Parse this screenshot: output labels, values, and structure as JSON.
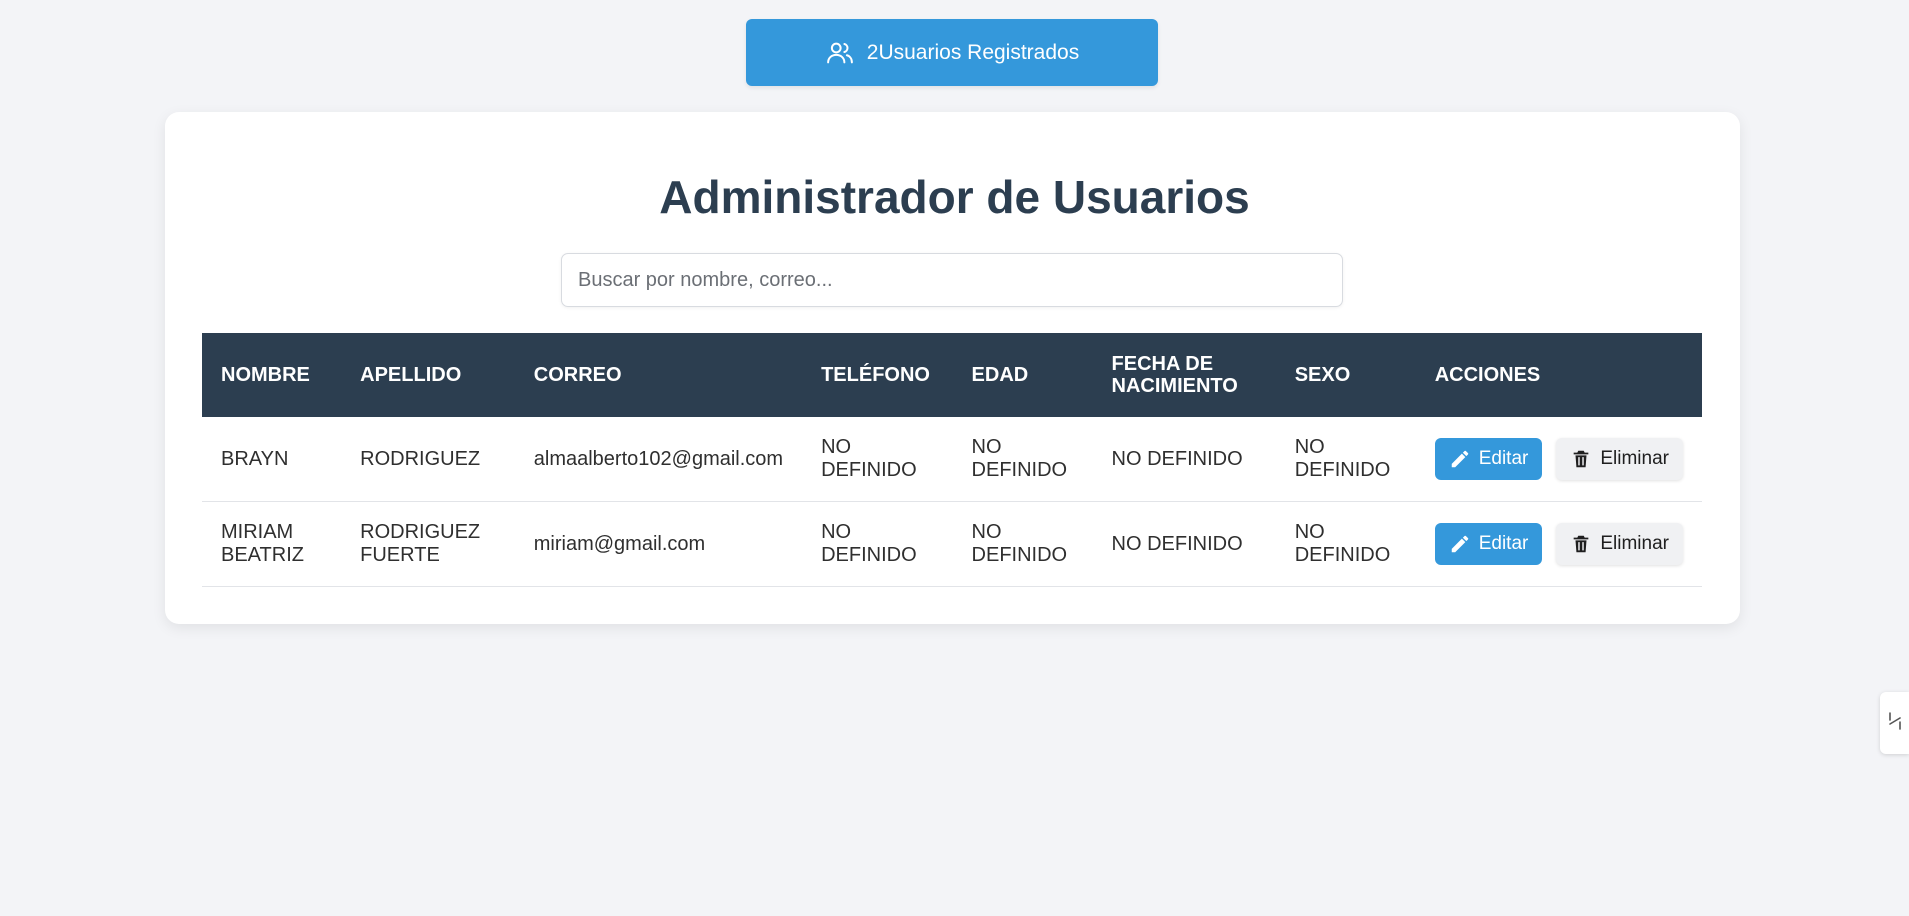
{
  "header": {
    "count": "2",
    "count_label": "Usuarios Registrados"
  },
  "main": {
    "title": "Administrador de Usuarios",
    "search_placeholder": "Buscar por nombre, correo..."
  },
  "table": {
    "columns": [
      "NOMBRE",
      "APELLIDO",
      "CORREO",
      "TELÉFONO",
      "EDAD",
      "FECHA DE NACIMIENTO",
      "SEXO",
      "ACCIONES"
    ],
    "rows": [
      {
        "nombre": "BRAYN",
        "apellido": "RODRIGUEZ",
        "correo": "almaalberto102@gmail.com",
        "telefono": "NO DEFINIDO",
        "edad": "NO DEFINIDO",
        "fecha": "NO DEFINIDO",
        "sexo": "NO DEFINIDO",
        "edit_label": "Editar",
        "delete_label": "Eliminar"
      },
      {
        "nombre": "MIRIAM BEATRIZ",
        "apellido": "RODRIGUEZ FUERTE",
        "correo": "miriam@gmail.com",
        "telefono": "NO DEFINIDO",
        "edad": "NO DEFINIDO",
        "fecha": "NO DEFINIDO",
        "sexo": "NO DEFINIDO",
        "edit_label": "Editar",
        "delete_label": "Eliminar"
      }
    ]
  },
  "icons": {
    "count_button": "users-icon",
    "edit": "pencil-icon",
    "delete": "trash-icon",
    "side_tab": "expand-arrows-icon"
  },
  "colors": {
    "accent": "#3498db",
    "header_dark": "#2c3e50",
    "background": "#f3f4f7"
  }
}
